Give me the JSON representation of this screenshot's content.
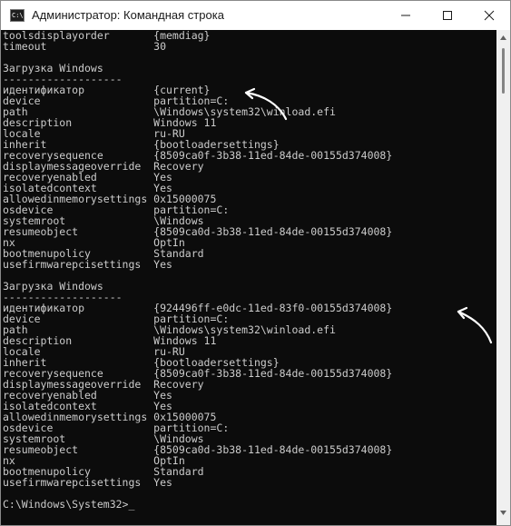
{
  "window": {
    "title": "Администратор: Командная строка",
    "icon_label": "C:\\",
    "colors": {
      "console_bg": "#0c0c0c",
      "console_text": "#cccccc",
      "arrow": "#ffffff"
    }
  },
  "controls": {
    "minimize_icon": "minimize-icon",
    "maximize_icon": "maximize-icon",
    "close_icon": "close-icon"
  },
  "console": {
    "lines": [
      "toolsdisplayorder       {memdiag}",
      "timeout                 30",
      "",
      "Загрузка Windows",
      "-------------------",
      "идентификатор           {current}",
      "device                  partition=C:",
      "path                    \\Windows\\system32\\winload.efi",
      "description             Windows 11",
      "locale                  ru-RU",
      "inherit                 {bootloadersettings}",
      "recoverysequence        {8509ca0f-3b38-11ed-84de-00155d374008}",
      "displaymessageoverride  Recovery",
      "recoveryenabled         Yes",
      "isolatedcontext         Yes",
      "allowedinmemorysettings 0x15000075",
      "osdevice                partition=C:",
      "systemroot              \\Windows",
      "resumeobject            {8509ca0d-3b38-11ed-84de-00155d374008}",
      "nx                      OptIn",
      "bootmenupolicy          Standard",
      "usefirmwarepcisettings  Yes",
      "",
      "Загрузка Windows",
      "-------------------",
      "идентификатор           {924496ff-e0dc-11ed-83f0-00155d374008}",
      "device                  partition=C:",
      "path                    \\Windows\\system32\\winload.efi",
      "description             Windows 11",
      "locale                  ru-RU",
      "inherit                 {bootloadersettings}",
      "recoverysequence        {8509ca0f-3b38-11ed-84de-00155d374008}",
      "displaymessageoverride  Recovery",
      "recoveryenabled         Yes",
      "isolatedcontext         Yes",
      "allowedinmemorysettings 0x15000075",
      "osdevice                partition=C:",
      "systemroot              \\Windows",
      "resumeobject            {8509ca0d-3b38-11ed-84de-00155d374008}",
      "nx                      OptIn",
      "bootmenupolicy          Standard",
      "usefirmwarepcisettings  Yes",
      "",
      "C:\\Windows\\System32>_"
    ]
  }
}
